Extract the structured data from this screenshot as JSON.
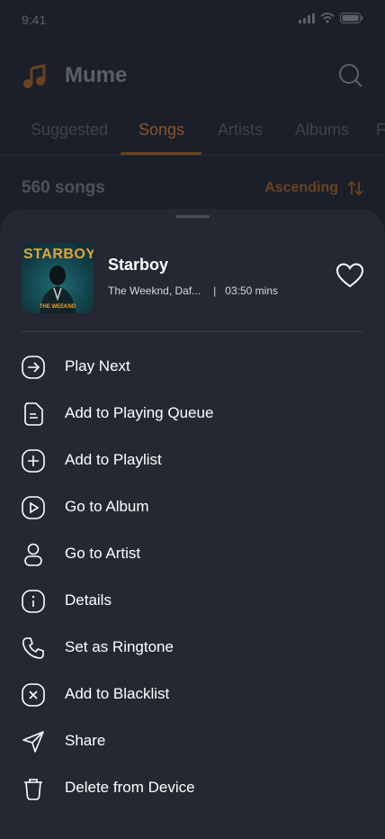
{
  "status_bar": {
    "time": "9:41"
  },
  "header": {
    "app_title": "Mume",
    "logo_icon": "music-note-icon",
    "search_icon": "search-icon"
  },
  "tabs": [
    {
      "label": "Suggested",
      "active": false
    },
    {
      "label": "Songs",
      "active": true
    },
    {
      "label": "Artists",
      "active": false
    },
    {
      "label": "Albums",
      "active": false
    },
    {
      "label": "F",
      "active": false
    }
  ],
  "list_header": {
    "count": "560 songs",
    "sort_label": "Ascending",
    "sort_icon": "sort-arrows-icon"
  },
  "sheet": {
    "song": {
      "cover_title": "STARBOY",
      "cover_subtitle": "THE WEEKND",
      "title": "Starboy",
      "artist": "The Weeknd, Daf...",
      "separator": "|",
      "duration": "03:50 mins",
      "favorite_icon": "heart-icon"
    },
    "menu": [
      {
        "label": "Play Next",
        "icon": "arrow-right-circle-icon"
      },
      {
        "label": "Add to Playing Queue",
        "icon": "queue-document-icon"
      },
      {
        "label": "Add to Playlist",
        "icon": "plus-circle-icon"
      },
      {
        "label": "Go to Album",
        "icon": "play-circle-icon"
      },
      {
        "label": "Go to Artist",
        "icon": "user-icon"
      },
      {
        "label": "Details",
        "icon": "info-circle-icon"
      },
      {
        "label": "Set as Ringtone",
        "icon": "phone-icon"
      },
      {
        "label": "Add to Blacklist",
        "icon": "x-circle-icon"
      },
      {
        "label": "Share",
        "icon": "send-icon"
      },
      {
        "label": "Delete from Device",
        "icon": "trash-icon"
      }
    ]
  },
  "colors": {
    "background": "#1b1f29",
    "sheet": "#252833",
    "accent_dimmed": "#8a5528",
    "text": "#ffffff"
  }
}
